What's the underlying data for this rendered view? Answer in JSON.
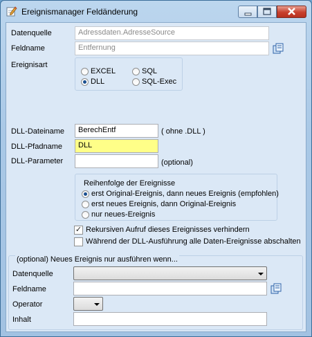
{
  "window": {
    "title": "Ereignismanager Feldänderung",
    "icon": "pencil-edit-icon",
    "buttons": {
      "minimize": "minimize-icon",
      "maximize": "maximize-icon",
      "close": "close-icon"
    }
  },
  "form": {
    "datenquelle_label": "Datenquelle",
    "datenquelle_value": "Adressdaten.AdresseSource",
    "feldname_label": "Feldname",
    "feldname_value": "Entfernung",
    "ereignisart_label": "Ereignisart",
    "ereignisart_options": [
      "EXCEL",
      "DLL",
      "SQL",
      "SQL-Exec"
    ],
    "ereignisart_selected": "DLL",
    "dll_dateiname_label": "DLL-Dateiname",
    "dll_dateiname_value": "BerechEntf",
    "dll_dateiname_hint": "( ohne .DLL )",
    "dll_pfadname_label": "DLL-Pfadname",
    "dll_pfadname_value": "DLL",
    "dll_parameter_label": "DLL-Parameter",
    "dll_parameter_value": "",
    "dll_parameter_hint": "(optional)"
  },
  "reihenfolge": {
    "title": "Reihenfolge der Ereignisse",
    "options": [
      "erst Original-Ereignis, dann neues Ereignis (empfohlen)",
      "erst neues Ereignis, dann Original-Ereignis",
      "nur neues-Ereignis"
    ],
    "selected_index": 0
  },
  "checkboxes": {
    "rekursiv_label": "Rekursiven Aufruf dieses Ereignisses verhindern",
    "rekursiv_checked": true,
    "dll_abschalten_label": "Während der DLL-Ausführung alle Daten-Ereignisse abschalten",
    "dll_abschalten_checked": false
  },
  "bedingung": {
    "title": "(optional) Neues Ereignis nur ausführen wenn...",
    "datenquelle_label": "Datenquelle",
    "datenquelle_value": "",
    "feldname_label": "Feldname",
    "feldname_value": "",
    "operator_label": "Operator",
    "operator_value": "",
    "inhalt_label": "Inhalt",
    "inhalt_value": ""
  },
  "colors": {
    "accent": "#1a4f90",
    "yellow_field": "#ffff88",
    "close_button": "#c8402e"
  }
}
